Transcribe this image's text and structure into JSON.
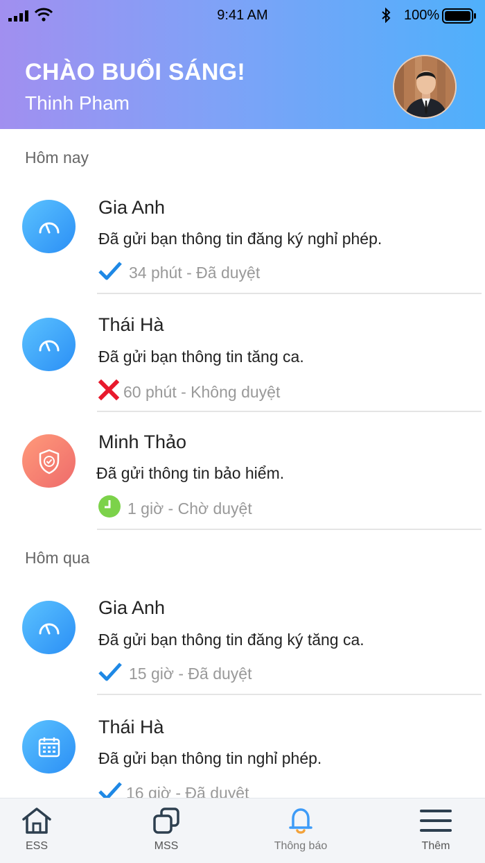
{
  "status_bar": {
    "time": "9:41 AM",
    "battery": "100%"
  },
  "header": {
    "greeting": "CHÀO BUỔI SÁNG!",
    "user_name": "Thinh Pham"
  },
  "sections": [
    {
      "label": "Hôm nay",
      "items": [
        {
          "sender": "Gia Anh",
          "message": "Đã gửi bạn thông tin đăng ký nghỉ phép.",
          "status": "34 phút - Đã duyệt",
          "status_icon": "check-icon",
          "icon": "speedometer-icon"
        },
        {
          "sender": "Thái Hà",
          "message": "Đã gửi bạn thông tin tăng ca.",
          "status": "60 phút - Không duyệt",
          "status_icon": "cross-icon",
          "icon": "speedometer-icon"
        },
        {
          "sender": "Minh Thảo",
          "message": "Đã gửi thông tin bảo hiểm.",
          "status": "1 giờ - Chờ duyệt",
          "status_icon": "clock-icon",
          "icon": "shield-check-icon"
        }
      ]
    },
    {
      "label": "Hôm qua",
      "items": [
        {
          "sender": "Gia Anh",
          "message": "Đã gửi bạn thông tin đăng ký tăng ca.",
          "status": "15 giờ - Đã duyệt",
          "status_icon": "check-icon",
          "icon": "speedometer-icon"
        },
        {
          "sender": "Thái Hà",
          "message": "Đã gửi bạn thông tin nghỉ phép.",
          "status": "16 giờ - Đã duyệt",
          "status_icon": "check-icon",
          "icon": "calendar-icon"
        }
      ]
    }
  ],
  "tabbar": {
    "tabs": [
      {
        "label": "ESS",
        "icon": "home-icon"
      },
      {
        "label": "MSS",
        "icon": "copy-icon"
      },
      {
        "label": "Thông báo",
        "icon": "bell-icon",
        "active": true
      },
      {
        "label": "Thêm",
        "icon": "menu-icon"
      }
    ]
  },
  "colors": {
    "accent": "#2b8ff5",
    "check": "#1e88e5",
    "cross": "#e8192c",
    "clock": "#7cd24a",
    "bell": "#3d9bf7"
  }
}
